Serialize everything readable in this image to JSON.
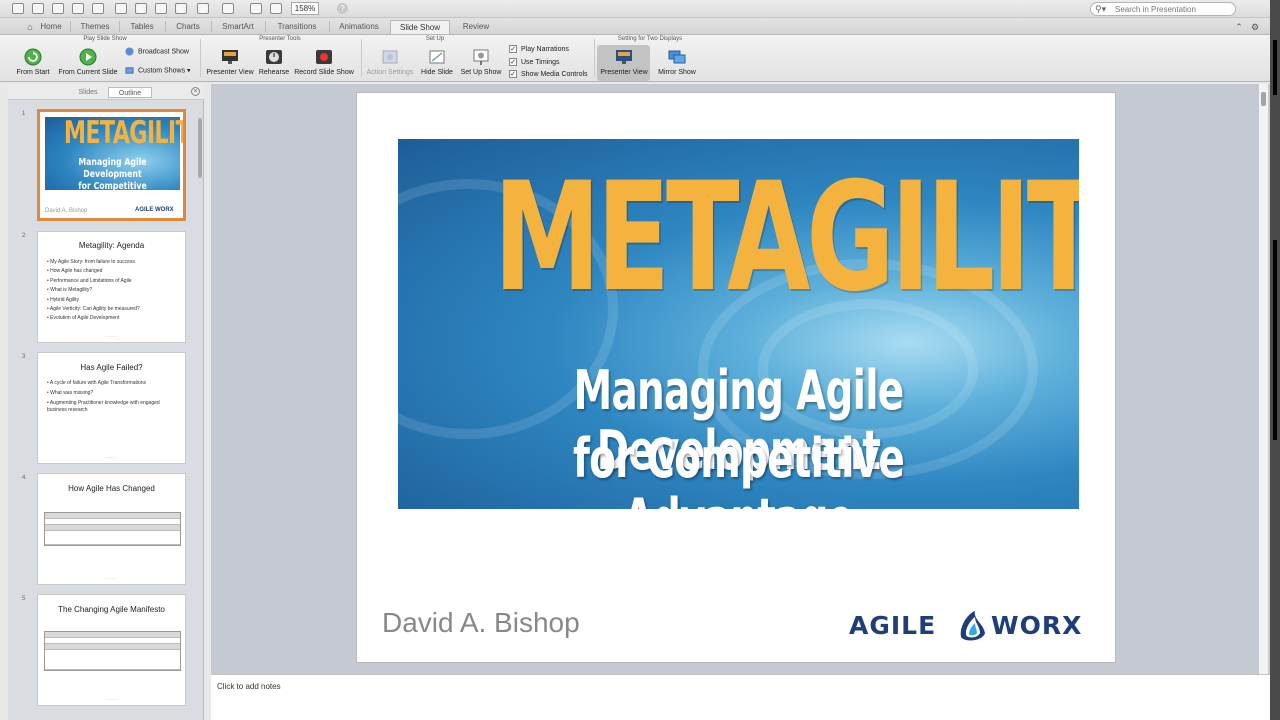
{
  "toolbar": {
    "zoom": "158%",
    "search_placeholder": "Search in Presentation"
  },
  "ribbon_tabs": [
    {
      "label": "Home"
    },
    {
      "label": "Themes"
    },
    {
      "label": "Tables"
    },
    {
      "label": "Charts"
    },
    {
      "label": "SmartArt"
    },
    {
      "label": "Transitions"
    },
    {
      "label": "Animations"
    },
    {
      "label": "Slide Show"
    },
    {
      "label": "Review"
    }
  ],
  "ribbon": {
    "groups": {
      "play": "Play Slide Show",
      "presenter": "Presenter Tools",
      "setup": "Set Up",
      "two_displays": "Setting for Two Displays"
    },
    "buttons": {
      "from_start": "From Start",
      "from_current": "From Current Slide",
      "broadcast": "Broadcast Show",
      "custom_shows": "Custom Shows",
      "presenter_view": "Presenter View",
      "rehearse": "Rehearse",
      "record": "Record Slide Show",
      "action_settings": "Action Settings",
      "hide_slide": "Hide Slide",
      "setup_show": "Set Up Show",
      "play_narrations": "Play Narrations",
      "use_timings": "Use Timings",
      "show_media": "Show Media Controls",
      "presenter_view_2": "Presenter View",
      "mirror_show": "Mirror Show"
    }
  },
  "left_panel": {
    "tab_slides": "Slides",
    "tab_outline": "Outline",
    "thumbnails": [
      {
        "num": "1",
        "title_main": "METAGILITY",
        "sub1": "Managing Agile Development",
        "sub2": "for Competitive Advantage",
        "author": "David A. Bishop",
        "logo": "AGILE WORX"
      },
      {
        "num": "2",
        "title": "Metagility: Agenda",
        "bullets": [
          "My Agile Story: from failure to success",
          "How Agile has changed",
          "Performance and Limitations of Agile",
          "What is Metagility?",
          "Hybrid Agility",
          "Agile Verticity: Can Agility be measured?",
          "Evolution of Agile Development"
        ]
      },
      {
        "num": "3",
        "title": "Has Agile Failed?",
        "bullets": [
          "A cycle of failure with Agile Transformations",
          "What was missing?",
          "Augmenting Practitioner knowledge with engaged business research"
        ]
      },
      {
        "num": "4",
        "title": "How Agile Has Changed"
      },
      {
        "num": "5",
        "title": "The Changing Agile Manifesto"
      }
    ]
  },
  "slide": {
    "title": "METAGILITY",
    "subtitle_line1": "Managing Agile Development",
    "subtitle_line2": "for Competitive Advantage",
    "author": "David A. Bishop",
    "logo_left": "AGILE",
    "logo_right": "WORX"
  },
  "notes": {
    "placeholder": "Click to add notes"
  }
}
